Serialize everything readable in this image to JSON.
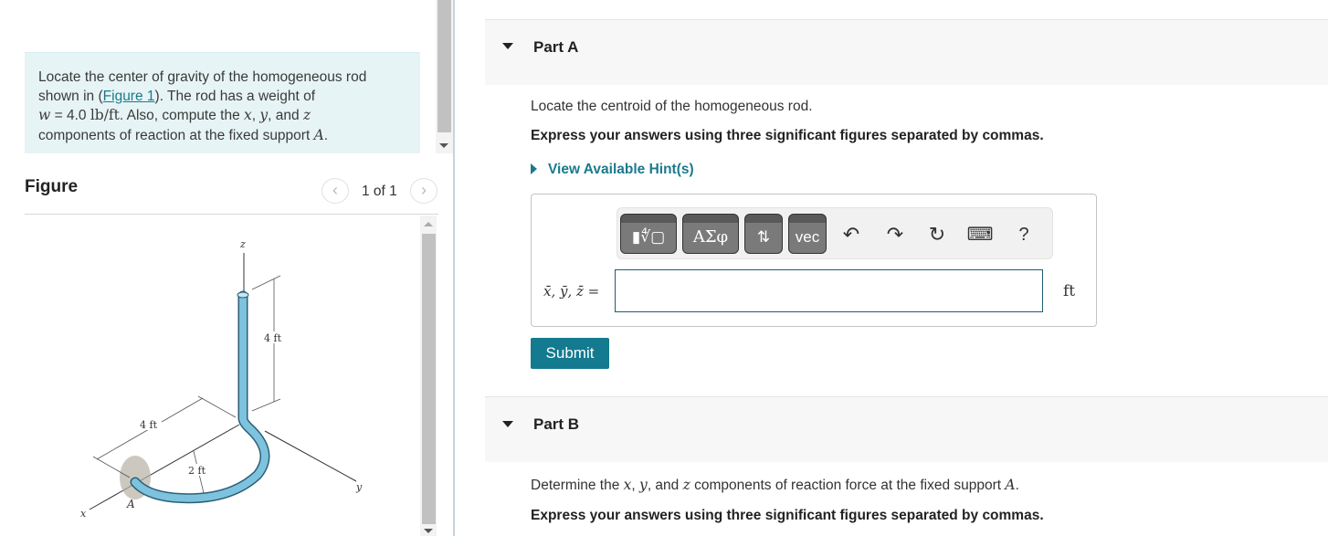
{
  "problem": {
    "text_1": "Locate the center of gravity of the homogeneous rod shown in (",
    "figure_link": "Figure 1",
    "text_2": "). The rod has a weight of",
    "w_var": "w",
    "w_eq": " = 4.0 ",
    "w_unit": "lb/ft",
    "text_3": ". Also, compute the ",
    "x": "x",
    "comma1": ", ",
    "y": "y",
    "and": ", and ",
    "z": "z",
    "text_4": "components of reaction at the fixed support ",
    "A": "A",
    "period": "."
  },
  "figure": {
    "title": "Figure",
    "pager": "1 of 1",
    "prev_icon": "chevron-left-icon",
    "next_icon": "chevron-right-icon",
    "prev_glyph": "‹",
    "next_glyph": "›",
    "labels": {
      "z_axis": "z",
      "y_axis": "y",
      "x_axis": "x",
      "support": "A",
      "dim_vertical": "4 ft",
      "dim_horizontal": "4 ft",
      "dim_radius": "2 ft"
    },
    "rod_color": "#7ec3dd"
  },
  "partA": {
    "title": "Part A",
    "prompt": "Locate the centroid of the homogeneous rod.",
    "instruction": "Express your answers using three significant figures separated by commas.",
    "hint_link": "View Available Hint(s)",
    "toolbar": {
      "templates": "▮∜▢",
      "greek": "ΑΣφ",
      "arrows": "⇅",
      "vec": "vec",
      "undo": "↶",
      "redo": "↷",
      "reset": "↻",
      "keyboard": "⌨",
      "help": "?"
    },
    "answer_label": "x̄, ȳ, z̄ =",
    "answer_value": "",
    "answer_unit": "ft",
    "submit": "Submit"
  },
  "partB": {
    "title": "Part B",
    "prompt_1": "Determine the ",
    "x": "x",
    "c1": ", ",
    "y": "y",
    "and": ", and ",
    "z": "z",
    "prompt_2": " components of reaction force at the fixed support ",
    "A": "A",
    "period": ".",
    "instruction": "Express your answers using three significant figures separated by commas."
  },
  "colors": {
    "accent": "#137a8f",
    "link": "#1a7a8c",
    "problem_bg": "#e7f4f5"
  }
}
